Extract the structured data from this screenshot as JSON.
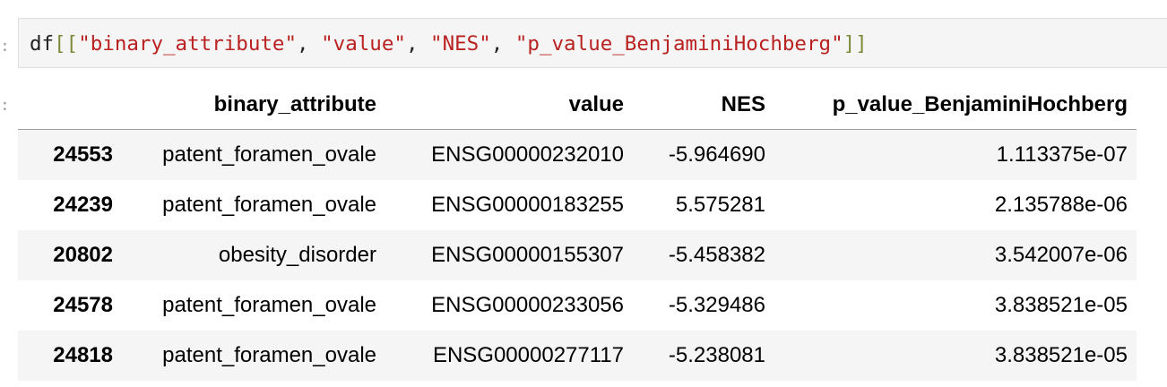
{
  "input_cell": {
    "gutter": ":",
    "code_tokens": [
      {
        "text": "df",
        "kind": "punct"
      },
      {
        "text": "[[",
        "kind": "bracket"
      },
      {
        "text": "\"binary_attribute\"",
        "kind": "str"
      },
      {
        "text": ", ",
        "kind": "punct"
      },
      {
        "text": "\"value\"",
        "kind": "str"
      },
      {
        "text": ", ",
        "kind": "punct"
      },
      {
        "text": "\"NES\"",
        "kind": "str"
      },
      {
        "text": ", ",
        "kind": "punct"
      },
      {
        "text": "\"p_value_BenjaminiHochberg\"",
        "kind": "str"
      },
      {
        "text": "]]",
        "kind": "bracket"
      }
    ]
  },
  "output_cell": {
    "gutter": ":",
    "table": {
      "columns": [
        "",
        "binary_attribute",
        "value",
        "NES",
        "p_value_BenjaminiHochberg"
      ],
      "rows": [
        {
          "index": "24553",
          "binary_attribute": "patent_foramen_ovale",
          "value": "ENSG00000232010",
          "NES": "-5.964690",
          "p_value": "1.113375e-07"
        },
        {
          "index": "24239",
          "binary_attribute": "patent_foramen_ovale",
          "value": "ENSG00000183255",
          "NES": "5.575281",
          "p_value": "2.135788e-06"
        },
        {
          "index": "20802",
          "binary_attribute": "obesity_disorder",
          "value": "ENSG00000155307",
          "NES": "-5.458382",
          "p_value": "3.542007e-06"
        },
        {
          "index": "24578",
          "binary_attribute": "patent_foramen_ovale",
          "value": "ENSG00000233056",
          "NES": "-5.329486",
          "p_value": "3.838521e-05"
        },
        {
          "index": "24818",
          "binary_attribute": "patent_foramen_ovale",
          "value": "ENSG00000277117",
          "NES": "-5.238081",
          "p_value": "3.838521e-05"
        }
      ]
    }
  },
  "colors": {
    "string_literal": "#ba2121",
    "bracket": "#7c8a3a",
    "input_background": "#f5f5f5",
    "striped_row": "#f5f5f5"
  }
}
